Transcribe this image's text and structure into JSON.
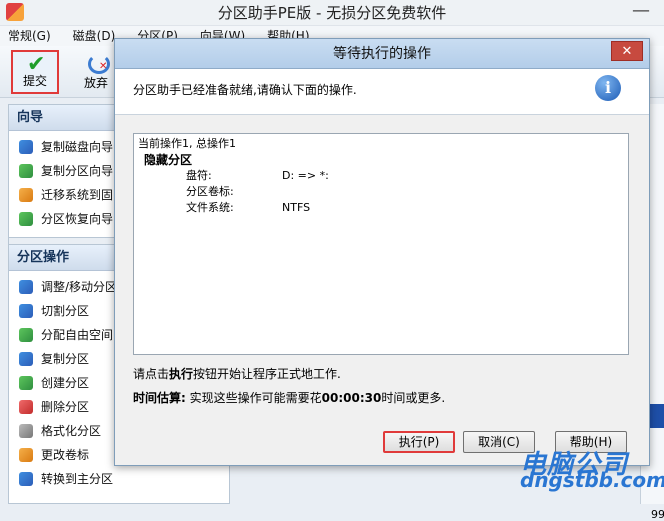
{
  "window": {
    "title": "分区助手PE版 - 无损分区免费软件"
  },
  "menu": [
    "常规(G)",
    "磁盘(D)",
    "分区(P)",
    "向导(W)",
    "帮助(H)"
  ],
  "toolbar": {
    "commit_label": "提交",
    "discard_label": "放弃"
  },
  "sidebar": {
    "wizard_header": "向导",
    "wizard_items": [
      "复制磁盘向导",
      "复制分区向导",
      "迁移系统到固",
      "分区恢复向导"
    ],
    "ops_header": "分区操作",
    "ops_items": [
      "调整/移动分区",
      "切割分区",
      "分配自由空间",
      "复制分区",
      "创建分区",
      "删除分区",
      "格式化分区",
      "更改卷标",
      "转换到主分区"
    ]
  },
  "dialog": {
    "title": "等待执行的操作",
    "close_symbol": "✕",
    "message": "分区助手已经准备就绪,请确认下面的操作.",
    "info_symbol": "i",
    "ops": {
      "summary": "当前操作1, 总操作1",
      "operation": "隐藏分区",
      "drive_label": "盘符:",
      "drive_value": "D: => *:",
      "volume_label": "分区卷标:",
      "volume_value": "",
      "fs_label": "文件系统:",
      "fs_value": "NTFS"
    },
    "hint_prefix": "请点击",
    "hint_bold": "执行",
    "hint_suffix": "按钮开始让程序正式地工作.",
    "estimate_label": "时间估算:",
    "estimate_prefix": " 实现这些操作可能需要花",
    "estimate_time": "00:00:30",
    "estimate_suffix": "时间或更多.",
    "execute_label": "执行(P)",
    "cancel_label": "取消(C)",
    "help_label": "帮助(H)"
  },
  "right_strip_text": "99",
  "watermark": {
    "line1": "电脑公司",
    "line2": "dngstbb.com"
  },
  "colors": {
    "highlight_border": "#e03a3a",
    "accent_blue": "#2a76d2"
  }
}
